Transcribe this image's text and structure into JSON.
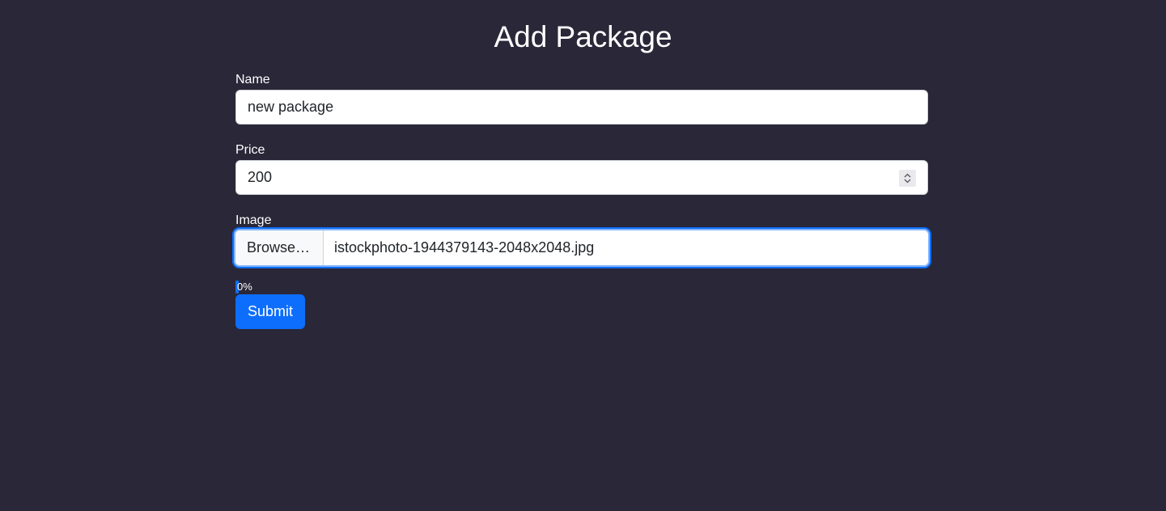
{
  "page": {
    "title": "Add Package"
  },
  "form": {
    "name": {
      "label": "Name",
      "value": "new package"
    },
    "price": {
      "label": "Price",
      "value": "200"
    },
    "image": {
      "label": "Image",
      "browse_label": "Browse…",
      "file_name": "istockphoto-1944379143-2048x2048.jpg"
    },
    "progress": {
      "percent": 0,
      "text": "0%"
    },
    "submit_label": "Submit"
  },
  "colors": {
    "background": "#2a2738",
    "accent": "#0d6efd",
    "focus_ring": "#86b7fe"
  },
  "icons": {
    "spinner": "up-down-chevron-icon"
  }
}
